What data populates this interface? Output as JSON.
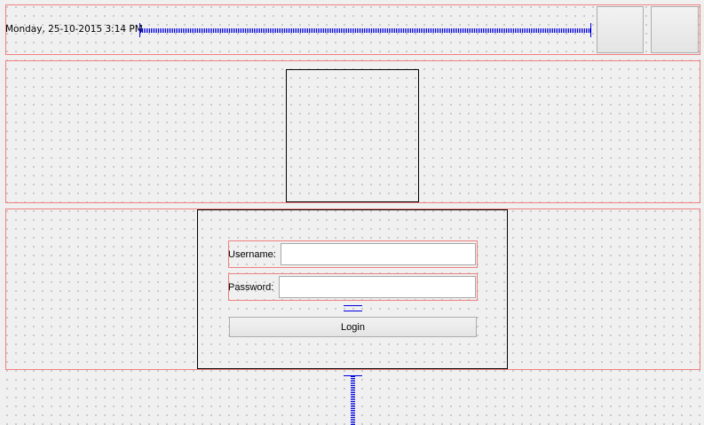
{
  "header": {
    "datetime": "Monday, 25-10-2015 3:14 PM"
  },
  "login": {
    "username_label": "Username:",
    "username_value": "",
    "password_label": "Password:",
    "password_value": "",
    "login_button": "Login"
  },
  "colors": {
    "layout_border": "#f08080",
    "spacer": "#0000e0"
  }
}
